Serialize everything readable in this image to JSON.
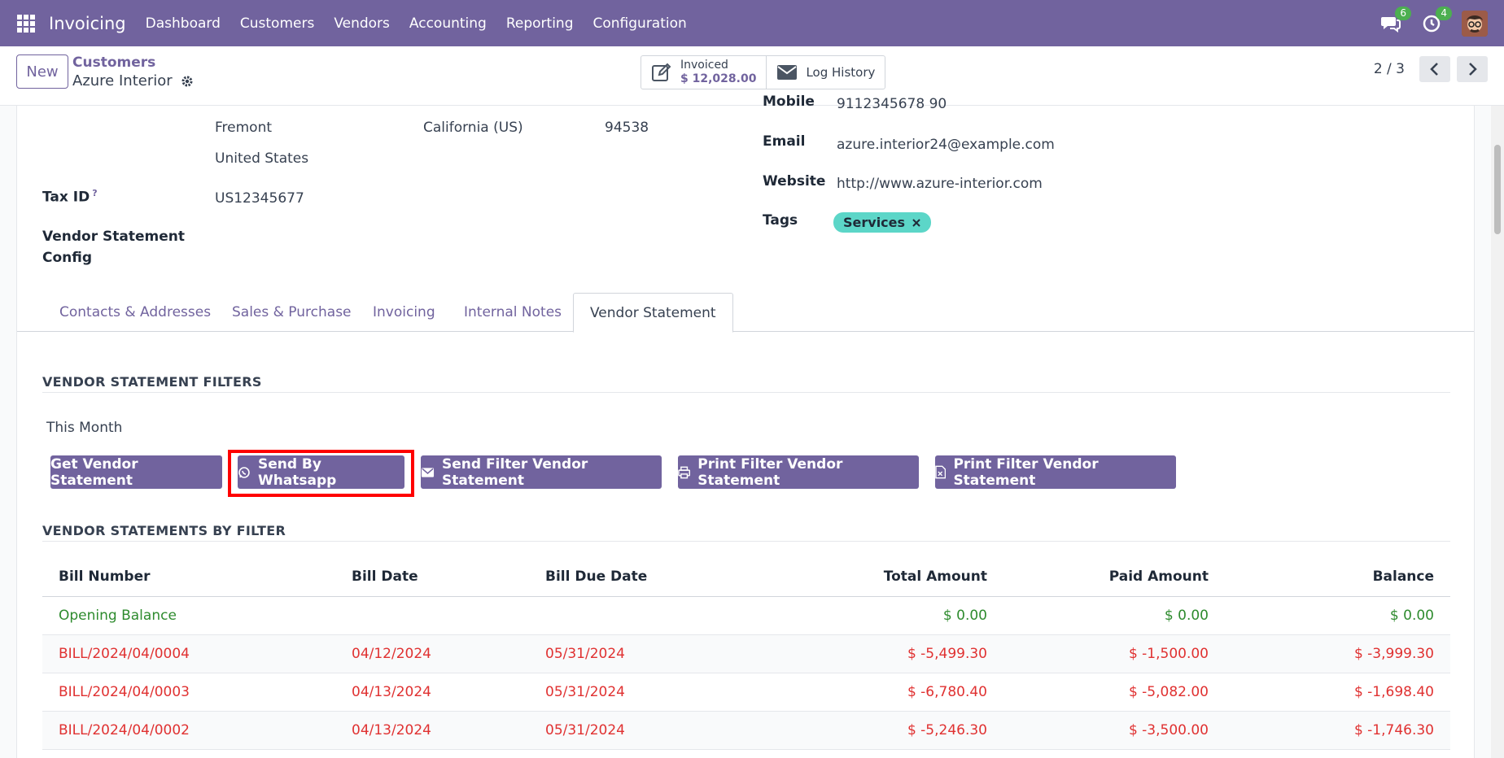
{
  "navbar": {
    "brand": "Invoicing",
    "menu": [
      "Dashboard",
      "Customers",
      "Vendors",
      "Accounting",
      "Reporting",
      "Configuration"
    ],
    "chat_badge": "6",
    "activity_badge": "4"
  },
  "control": {
    "new_label": "New",
    "breadcrumb_parent": "Customers",
    "breadcrumb_current": "Azure Interior",
    "invoiced_label": "Invoiced",
    "invoiced_value": "$ 12,028.00",
    "log_history_label": "Log History",
    "pager": "2 / 3"
  },
  "address": {
    "city": "Fremont",
    "state": "California (US)",
    "zip": "94538",
    "country": "United States",
    "mobile_label": "Mobile",
    "mobile_value": "9112345678 90",
    "tax_id_label": "Tax ID",
    "tax_id_help": "?",
    "tax_id_value": "US12345677",
    "vendor_statement_config_label": "Vendor Statement Config",
    "email_label": "Email",
    "email_value": "azure.interior24@example.com",
    "website_label": "Website",
    "website_value": "http://www.azure-interior.com",
    "tags_label": "Tags",
    "tag_services": "Services"
  },
  "tabs": [
    "Contacts & Addresses",
    "Sales & Purchase",
    "Invoicing",
    "Internal Notes",
    "Vendor Statement"
  ],
  "active_tab": "Vendor Statement",
  "filters": {
    "section_title": "VENDOR STATEMENT FILTERS",
    "period": "This Month",
    "buttons": {
      "get": "Get Vendor Statement",
      "whatsapp": "Send By Whatsapp",
      "send_filter": "Send Filter Vendor Statement",
      "print_filter": "Print Filter Vendor Statement",
      "print_filter_xls": "Print Filter Vendor Statement"
    }
  },
  "statements": {
    "section_title": "VENDOR STATEMENTS BY FILTER",
    "columns": [
      "Bill Number",
      "Bill Date",
      "Bill Due Date",
      "Total Amount",
      "Paid Amount",
      "Balance"
    ],
    "rows": [
      {
        "bill": "Opening Balance",
        "date": "",
        "due": "",
        "total": "$ 0.00",
        "paid": "$ 0.00",
        "balance": "$ 0.00",
        "status": "green"
      },
      {
        "bill": "BILL/2024/04/0004",
        "date": "04/12/2024",
        "due": "05/31/2024",
        "total": "$ -5,499.30",
        "paid": "$ -1,500.00",
        "balance": "$ -3,999.30",
        "status": "red"
      },
      {
        "bill": "BILL/2024/04/0003",
        "date": "04/13/2024",
        "due": "05/31/2024",
        "total": "$ -6,780.40",
        "paid": "$ -5,082.00",
        "balance": "$ -1,698.40",
        "status": "red"
      },
      {
        "bill": "BILL/2024/04/0002",
        "date": "04/13/2024",
        "due": "05/31/2024",
        "total": "$ -5,246.30",
        "paid": "$ -3,500.00",
        "balance": "$ -1,746.30",
        "status": "red"
      }
    ]
  },
  "colors": {
    "brand": "#71639e",
    "positive": "#2e8b2e",
    "negative": "#e03131",
    "tag": "#5cd6c8",
    "highlight": "#ff0000"
  }
}
